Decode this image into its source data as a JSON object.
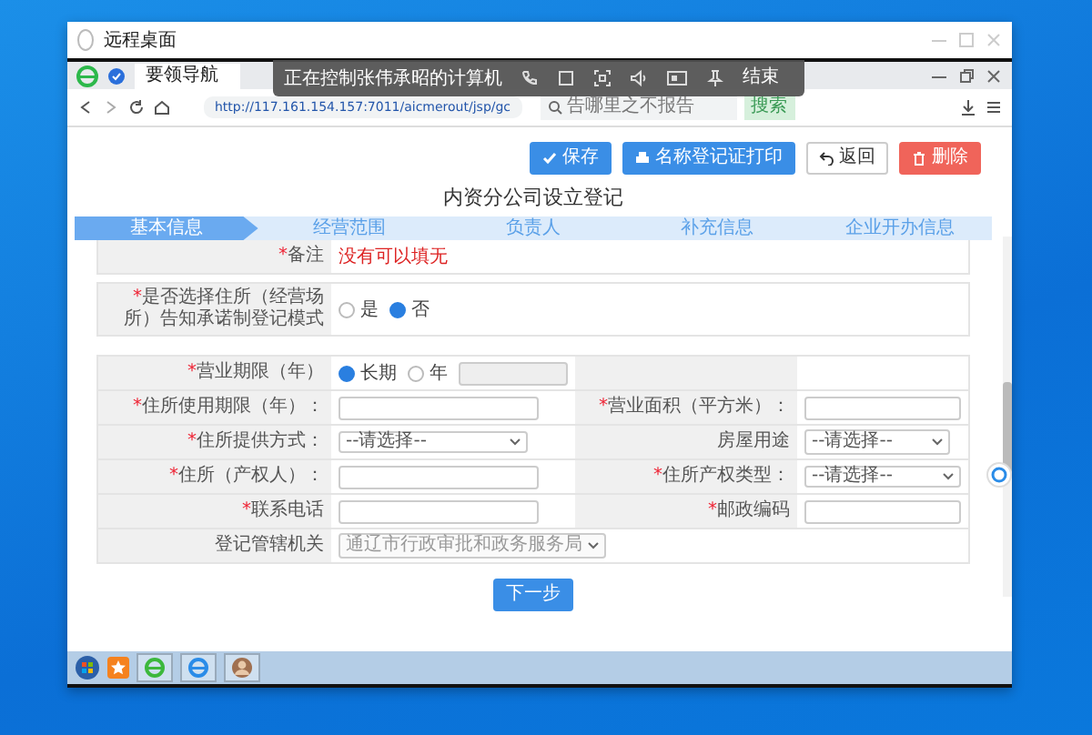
{
  "window": {
    "title": "远程桌面"
  },
  "remote_toolbar": {
    "status": "正在控制张伟承昭的计算机",
    "end_button": "结束"
  },
  "browser": {
    "tabs": [
      {
        "label": "要领导航",
        "selected": true
      }
    ],
    "url": "http://117.161.154.157:7011/aicmerout/jsp/gc",
    "search": {
      "placeholder": "告哪里之不报告",
      "button": "搜索"
    }
  },
  "actions": [
    {
      "label": "保存",
      "kind": "save"
    },
    {
      "label": "名称登记证打印",
      "kind": "print"
    },
    {
      "label": "返回",
      "kind": "back"
    },
    {
      "label": "删除",
      "kind": "delete"
    }
  ],
  "page_title": "内资分公司设立登记",
  "steps": [
    {
      "label": "基本信息",
      "selected": true
    },
    {
      "label": "经营范围",
      "selected": false
    },
    {
      "label": "负责人",
      "selected": false
    },
    {
      "label": "补充信息",
      "selected": false
    },
    {
      "label": "企业开办信息",
      "selected": false
    }
  ],
  "form": {
    "top_rows": [
      {
        "fields": [
          {
            "kind": "note",
            "mark": "*",
            "label": "备注",
            "hint": "没有可以填无"
          }
        ]
      },
      {
        "fields": [
          {
            "kind": "radio",
            "mark": "*",
            "label": "是否选择住所（经营场所）告知承诺制登记模式",
            "options": [
              {
                "label": "是",
                "selected": false
              },
              {
                "label": "否",
                "selected": true
              }
            ]
          }
        ]
      }
    ],
    "grid_rows": [
      {
        "fields": [
          {
            "kind": "radio_input",
            "mark": "*",
            "label": "营业期限（年）",
            "options": [
              {
                "label": "长期",
                "selected": true
              },
              {
                "label": "年",
                "selected": false
              }
            ]
          },
          {
            "kind": "blank"
          }
        ]
      },
      {
        "fields": [
          {
            "kind": "text",
            "mark": "*",
            "label": "住所使用期限（年）："
          },
          {
            "kind": "text",
            "mark": "*",
            "label": "营业面积（平方米）："
          }
        ]
      },
      {
        "fields": [
          {
            "kind": "select",
            "mark": "*",
            "label": "住所提供方式：",
            "value": "--请选择--"
          },
          {
            "kind": "select_short",
            "label": "房屋用途",
            "value": "--请选择--"
          }
        ]
      },
      {
        "fields": [
          {
            "kind": "text",
            "mark": "*",
            "label": "住所（产权人）："
          },
          {
            "kind": "select",
            "mark": "*",
            "label": "住所产权类型：",
            "value": "--请选择--"
          }
        ]
      },
      {
        "fields": [
          {
            "kind": "text",
            "mark": "*",
            "label": "联系电话"
          },
          {
            "kind": "text",
            "mark": "*",
            "label": "邮政编码"
          }
        ]
      },
      {
        "fields": [
          {
            "kind": "select_wide",
            "label": "登记管辖机关",
            "placeholder": "通辽市行政审批和政务服务局"
          }
        ]
      }
    ]
  },
  "next_button": "下一步"
}
